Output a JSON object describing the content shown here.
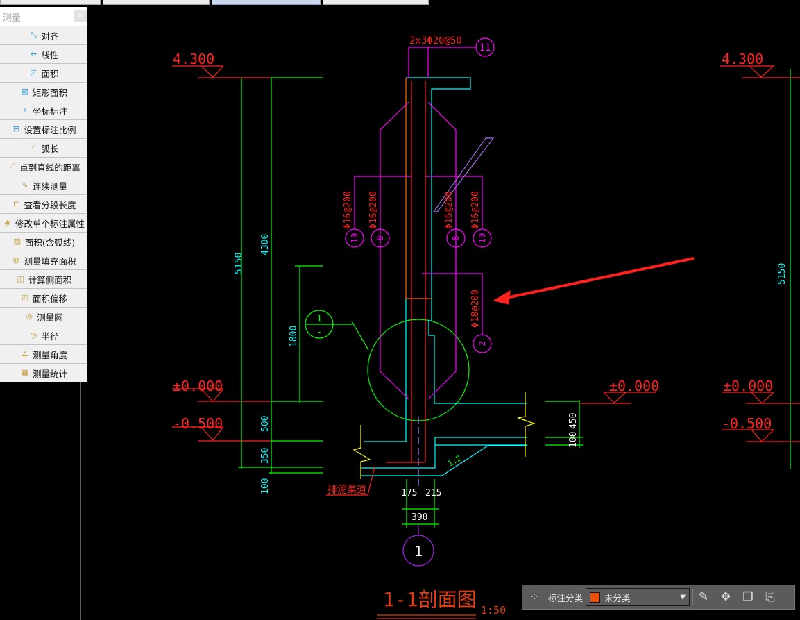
{
  "tabs": [
    {
      "label": ""
    },
    {
      "label": ""
    },
    {
      "label": "",
      "active": true
    },
    {
      "label": ""
    }
  ],
  "panel": {
    "title": "测量",
    "close": "×",
    "items": [
      {
        "label": "对齐",
        "icon": "align-dimension-icon"
      },
      {
        "label": "线性",
        "icon": "linear-dimension-icon"
      },
      {
        "label": "面积",
        "icon": "area-icon"
      },
      {
        "label": "矩形面积",
        "icon": "rect-area-icon"
      },
      {
        "label": "坐标标注",
        "icon": "coordinate-icon"
      },
      {
        "label": "设置标注比例",
        "icon": "scale-ruler-icon"
      },
      {
        "label": "弧长",
        "icon": "arc-length-icon"
      },
      {
        "label": "点到直线的距离",
        "icon": "point-line-distance-icon"
      },
      {
        "label": "连续测量",
        "icon": "continuous-measure-icon"
      },
      {
        "label": "查看分段长度",
        "icon": "segment-length-icon"
      },
      {
        "label": "修改单个标注属性",
        "icon": "edit-dimension-icon"
      },
      {
        "label": "面积(含弧线)",
        "icon": "arc-area-icon"
      },
      {
        "label": "测量填充面积",
        "icon": "hatch-area-icon"
      },
      {
        "label": "计算侧面积",
        "icon": "side-area-icon"
      },
      {
        "label": "面积偏移",
        "icon": "area-offset-icon"
      },
      {
        "label": "测量圆",
        "icon": "measure-circle-icon"
      },
      {
        "label": "半径",
        "icon": "radius-icon"
      },
      {
        "label": "测量角度",
        "icon": "angle-icon"
      },
      {
        "label": "测量统计",
        "icon": "statistics-icon"
      }
    ]
  },
  "drawing": {
    "levels": {
      "top": "4.300",
      "zero": "±0.000",
      "minus": "-0.500"
    },
    "dims": {
      "d5150": "5150",
      "d4300": "4300",
      "d1800": "1800",
      "d500": "500",
      "d350": "350",
      "d100": "100",
      "d450": "450",
      "d100r": "100",
      "d175": "175",
      "d215": "215",
      "d390": "390"
    },
    "rebar": {
      "top": "2x3Φ20@50",
      "top_tag": "11",
      "phi16": "Φ16@200",
      "tag10": "10",
      "tag8": "8",
      "phi18": "Φ18@200",
      "tag2": "2"
    },
    "detail_tag": {
      "num": "1",
      "sub": "-"
    },
    "slope": "1:2",
    "channel_label": "排泥渠道",
    "axis_tag": "1",
    "title": "1-1剖面图",
    "scale": "1:50",
    "colors": {
      "level": "#ff2020",
      "dim": "#00ff00",
      "dim_text": "#00ffff",
      "rebar": "#ff00ff",
      "concrete": "#00ffff",
      "title": "#e03c10",
      "arrow": "#ff2020"
    }
  },
  "toolbar": {
    "category_label": "标注分类",
    "category_value": "未分类",
    "swatch": "#e8500a"
  }
}
